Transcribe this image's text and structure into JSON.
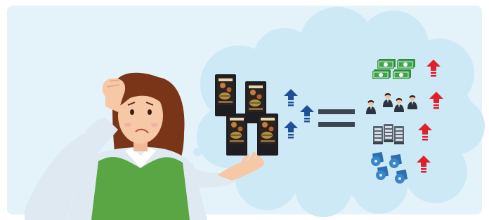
{
  "scene": {
    "background_color": "#e4f2fa",
    "cloud_color": "#cde9f6",
    "up_arrow_color_blue": "#1f4e9a",
    "up_arrow_color_red": "#e0202a",
    "equals_color": "#3c4650",
    "money_color": "#3ea34a",
    "server_color": "#5a6470",
    "disc_color": "#3a86c8",
    "shirt_color": "#dfe9f1",
    "vest_color": "#5aa544",
    "hair_color": "#7a3518",
    "skin_color": "#f7c8a6"
  },
  "illustration": {
    "person": "confused-woman-holding-displays",
    "displays_count": 4,
    "blue_arrows_count": 3,
    "result_rows": [
      "cost",
      "staff",
      "servers",
      "discs"
    ],
    "red_arrows_count": 4
  }
}
